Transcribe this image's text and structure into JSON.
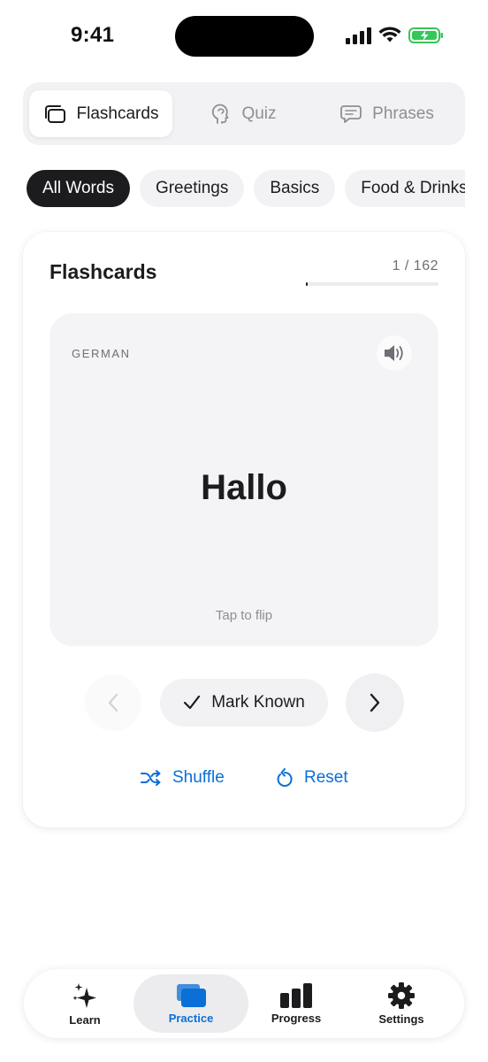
{
  "status": {
    "time": "9:41"
  },
  "segmented": [
    {
      "label": "Flashcards",
      "icon": "cards-icon",
      "active": true
    },
    {
      "label": "Quiz",
      "icon": "head-icon",
      "active": false
    },
    {
      "label": "Phrases",
      "icon": "chat-bubble-icon",
      "active": false
    }
  ],
  "chips": [
    "All Words",
    "Greetings",
    "Basics",
    "Food & Drinks"
  ],
  "card": {
    "title": "Flashcards",
    "counter": "1 / 162",
    "progress_fraction": 0.006,
    "language": "GERMAN",
    "word": "Hallo",
    "hint": "Tap to flip",
    "mark_known": "Mark Known",
    "shuffle": "Shuffle",
    "reset": "Reset"
  },
  "tabbar": {
    "learn": "Learn",
    "practice": "Practice",
    "progress": "Progress",
    "settings": "Settings"
  },
  "colors": {
    "accent": "#0a6fd6",
    "dark": "#1c1c1e",
    "battery": "#34c759"
  }
}
